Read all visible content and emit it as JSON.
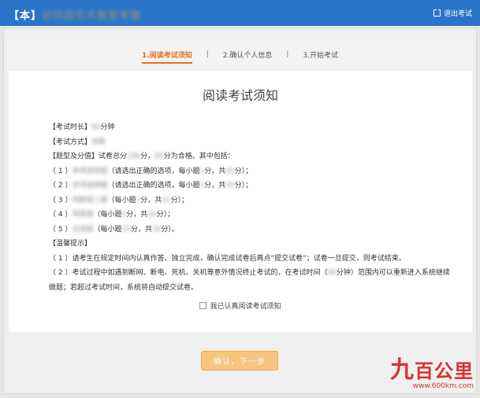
{
  "header": {
    "brand_prefix": "【本】",
    "brand_blur": "幼师园艺术教育考题",
    "exit_label": "退出考试"
  },
  "steps": [
    {
      "label": "1.阅读考试须知"
    },
    {
      "label": "2.确认个人信息"
    },
    {
      "label": "3.开始考试"
    }
  ],
  "step_separator": "|",
  "page": {
    "title": "阅读考试须知"
  },
  "notice": {
    "duration_label": "【考试时长】",
    "duration_value": "90",
    "duration_unit": "分钟",
    "method_label": "【考试方式】",
    "method_value": "闭卷",
    "score_label": "【题型及分值】",
    "score_a": "试卷总分",
    "score_total": "100",
    "score_b": "分，",
    "score_pass": "60",
    "score_c": "分为合格。其中包括：",
    "items": [
      {
        "num": "（ 1 ）",
        "blur": "单项选择题",
        "text_a": "（请选出正确的选项，每小题",
        "b1": "1",
        "text_b": "分，共",
        "b2": "20",
        "text_c": "分）；"
      },
      {
        "num": "（ 2 ）",
        "blur": "多项选择题",
        "text_a": "（请选出正确的选项，每小题",
        "b1": "2",
        "text_b": "分，共",
        "b2": "20",
        "text_c": "分）；"
      },
      {
        "num": "（ 3 ）",
        "blur": "判断题二题",
        "text_a": "（每小题",
        "b1": "1",
        "text_b": "分，共",
        "b2": "10",
        "text_c": "分）；"
      },
      {
        "num": "（ 4 ）",
        "blur": "简答题",
        "text_a": "（每小题",
        "b1": "5",
        "text_b": "分，共",
        "b2": "20",
        "text_c": "分）；"
      },
      {
        "num": "（ 5 ）",
        "blur": "论述题",
        "text_a": "（每小题",
        "b1": "15",
        "text_b": "分，共",
        "b2": "30",
        "text_c": "分）。"
      }
    ],
    "tips_label": "【温馨提示】",
    "tip1": "（ 1 ）请考生在规定时间内认真作答、独立完成，确认完成试卷后再点“提交试卷”；试卷一旦提交，则考试结束。",
    "tip2_a": "（ 2 ）考试过程中如遇到断网、断电、死机、关机等意外情况终止考试的，在考试时间（",
    "tip2_blur": "90",
    "tip2_b": "分钟）范围内可以重新进入系统继续做题；若超过考试时间，系统将自动提交试卷。"
  },
  "agree": {
    "label": "我已认真阅读考试须知",
    "checked": false
  },
  "confirm_button": {
    "label": "确认，下一步"
  },
  "watermark": {
    "logo_big": "九",
    "logo_rest": "百公里",
    "url": "www.600km.com"
  },
  "colors": {
    "header_blue": "#2a74c9",
    "active_step_orange": "#e8711c",
    "button_orange": "#f8c47e",
    "watermark_red": "#d8322f"
  }
}
